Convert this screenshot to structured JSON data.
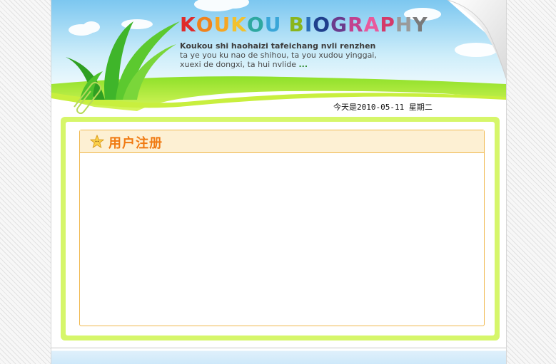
{
  "header": {
    "title_letters": [
      {
        "ch": "K",
        "color": "#e02a2a"
      },
      {
        "ch": "O",
        "color": "#f0821c"
      },
      {
        "ch": "U",
        "color": "#f5a623"
      },
      {
        "ch": "K",
        "color": "#f2c12e"
      },
      {
        "ch": "O",
        "color": "#2ea8a0"
      },
      {
        "ch": "U",
        "color": "#3aa6d8"
      },
      {
        "ch": " ",
        "color": "#ffffff"
      },
      {
        "ch": "B",
        "color": "#8ab51d"
      },
      {
        "ch": "I",
        "color": "#2b6fb8"
      },
      {
        "ch": "O",
        "color": "#1f3f8c"
      },
      {
        "ch": "G",
        "color": "#6b3a8c"
      },
      {
        "ch": "R",
        "color": "#c2418f"
      },
      {
        "ch": "A",
        "color": "#e85a9c"
      },
      {
        "ch": "P",
        "color": "#d43a6a"
      },
      {
        "ch": "H",
        "color": "#9a9a9a"
      },
      {
        "ch": "Y",
        "color": "#7a7a7a"
      }
    ],
    "tagline_head": "Koukou shi haohaizi tafeichang nvli renzhen",
    "tagline_body": "ta ye you ku nao de shihou, ta you xudou yinggai, xuexi de dongxi, ta hui nvlide",
    "tagline_more": "...",
    "date_text": "今天是2010-05-11 星期二"
  },
  "panel": {
    "title": "用户注册",
    "icon": "star-icon"
  },
  "colors": {
    "frame_green": "#d6f66a",
    "panel_border": "#f0b84e",
    "panel_header_bg": "#fdf0d3",
    "title_orange": "#f07a12"
  }
}
